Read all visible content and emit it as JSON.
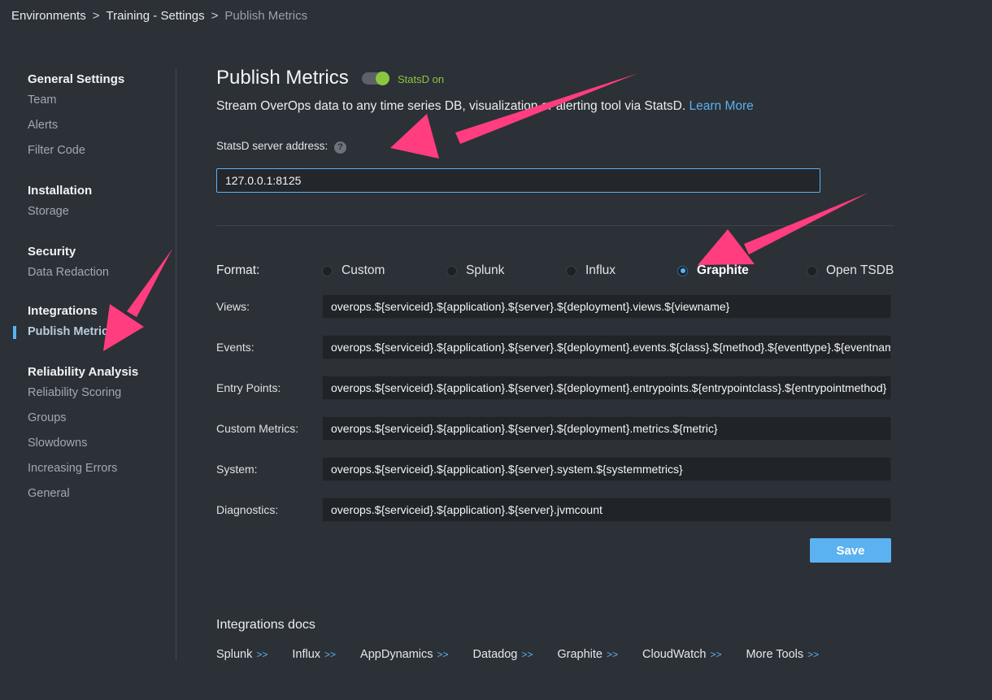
{
  "breadcrumb": {
    "items": [
      "Environments",
      "Training - Settings",
      "Publish Metrics"
    ],
    "separator": ">"
  },
  "sidebar": {
    "groups": [
      {
        "title": "General Settings",
        "items": [
          "Team",
          "Alerts",
          "Filter Code"
        ]
      },
      {
        "title": "Installation",
        "items": [
          "Storage"
        ]
      },
      {
        "title": "Security",
        "items": [
          "Data Redaction"
        ]
      },
      {
        "title": "Integrations",
        "items": [
          "Publish Metrics"
        ]
      },
      {
        "title": "Reliability Analysis",
        "items": [
          "Reliability Scoring",
          "Groups",
          "Slowdowns",
          "Increasing Errors",
          "General"
        ]
      }
    ],
    "active_item": "Publish Metrics"
  },
  "header": {
    "title": "Publish Metrics",
    "toggle_label": "StatsD on",
    "toggle_on": true,
    "description": "Stream OverOps data to any time series DB, visualization or alerting tool via StatsD.",
    "learn_more": "Learn More"
  },
  "address": {
    "label": "StatsD server address:",
    "help": "?",
    "value": "127.0.0.1:8125"
  },
  "format": {
    "label": "Format:",
    "options": [
      "Custom",
      "Splunk",
      "Influx",
      "Graphite",
      "Open TSDB"
    ],
    "selected": "Graphite"
  },
  "rows": [
    {
      "label": "Views:",
      "value": "overops.${serviceid}.${application}.${server}.${deployment}.views.${viewname}"
    },
    {
      "label": "Events:",
      "value": "overops.${serviceid}.${application}.${server}.${deployment}.events.${class}.${method}.${eventtype}.${eventname}"
    },
    {
      "label": "Entry Points:",
      "value": "overops.${serviceid}.${application}.${server}.${deployment}.entrypoints.${entrypointclass}.${entrypointmethod}"
    },
    {
      "label": "Custom Metrics:",
      "value": "overops.${serviceid}.${application}.${server}.${deployment}.metrics.${metric}"
    },
    {
      "label": "System:",
      "value": "overops.${serviceid}.${application}.${server}.system.${systemmetrics}"
    },
    {
      "label": "Diagnostics:",
      "value": "overops.${serviceid}.${application}.${server}.jvmcount"
    }
  ],
  "save_label": "Save",
  "docs": {
    "title": "Integrations docs",
    "links": [
      "Splunk",
      "Influx",
      "AppDynamics",
      "Datadog",
      "Graphite",
      "CloudWatch",
      "More Tools"
    ],
    "arrow": ">>"
  },
  "colors": {
    "background": "#2c3037",
    "accent": "#5bb2f0",
    "toggle_on": "#8cc63f",
    "annotation_arrow": "#ff3d7f"
  }
}
